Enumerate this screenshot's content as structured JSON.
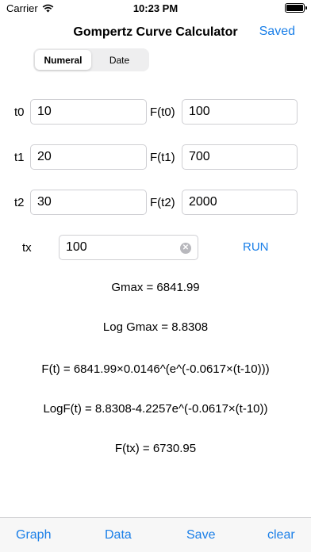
{
  "status": {
    "carrier": "Carrier",
    "time": "10:23 PM"
  },
  "nav": {
    "title": "Gompertz Curve Calculator",
    "saved_label": "Saved"
  },
  "segments": [
    {
      "label": "Numeral",
      "selected": true
    },
    {
      "label": "Date",
      "selected": false
    }
  ],
  "inputs": {
    "t0": {
      "label": "t0",
      "value": "10"
    },
    "f_t0": {
      "label": "F(t0)",
      "value": "100"
    },
    "t1": {
      "label": "t1",
      "value": "20"
    },
    "f_t1": {
      "label": "F(t1)",
      "value": "700"
    },
    "t2": {
      "label": "t2",
      "value": "30"
    },
    "f_t2": {
      "label": "F(t2)",
      "value": "2000"
    },
    "tx": {
      "label": "tx",
      "value": "100"
    }
  },
  "run_label": "RUN",
  "results": {
    "gmax": "Gmax = 6841.99",
    "log_gmax": "Log Gmax = 8.8308",
    "formula": "F(t) = 6841.99×0.0146^(e^(-0.0617×(t-10)))",
    "log_formula": "LogF(t) = 8.8308-4.2257e^(-0.0617×(t-10))",
    "f_tx": "F(tx) = 6730.95"
  },
  "toolbar": {
    "graph": "Graph",
    "data": "Data",
    "save": "Save",
    "clear": "clear"
  },
  "colors": {
    "accent": "#1a7fe8",
    "toolbar_bg": "#f7f7f7"
  }
}
